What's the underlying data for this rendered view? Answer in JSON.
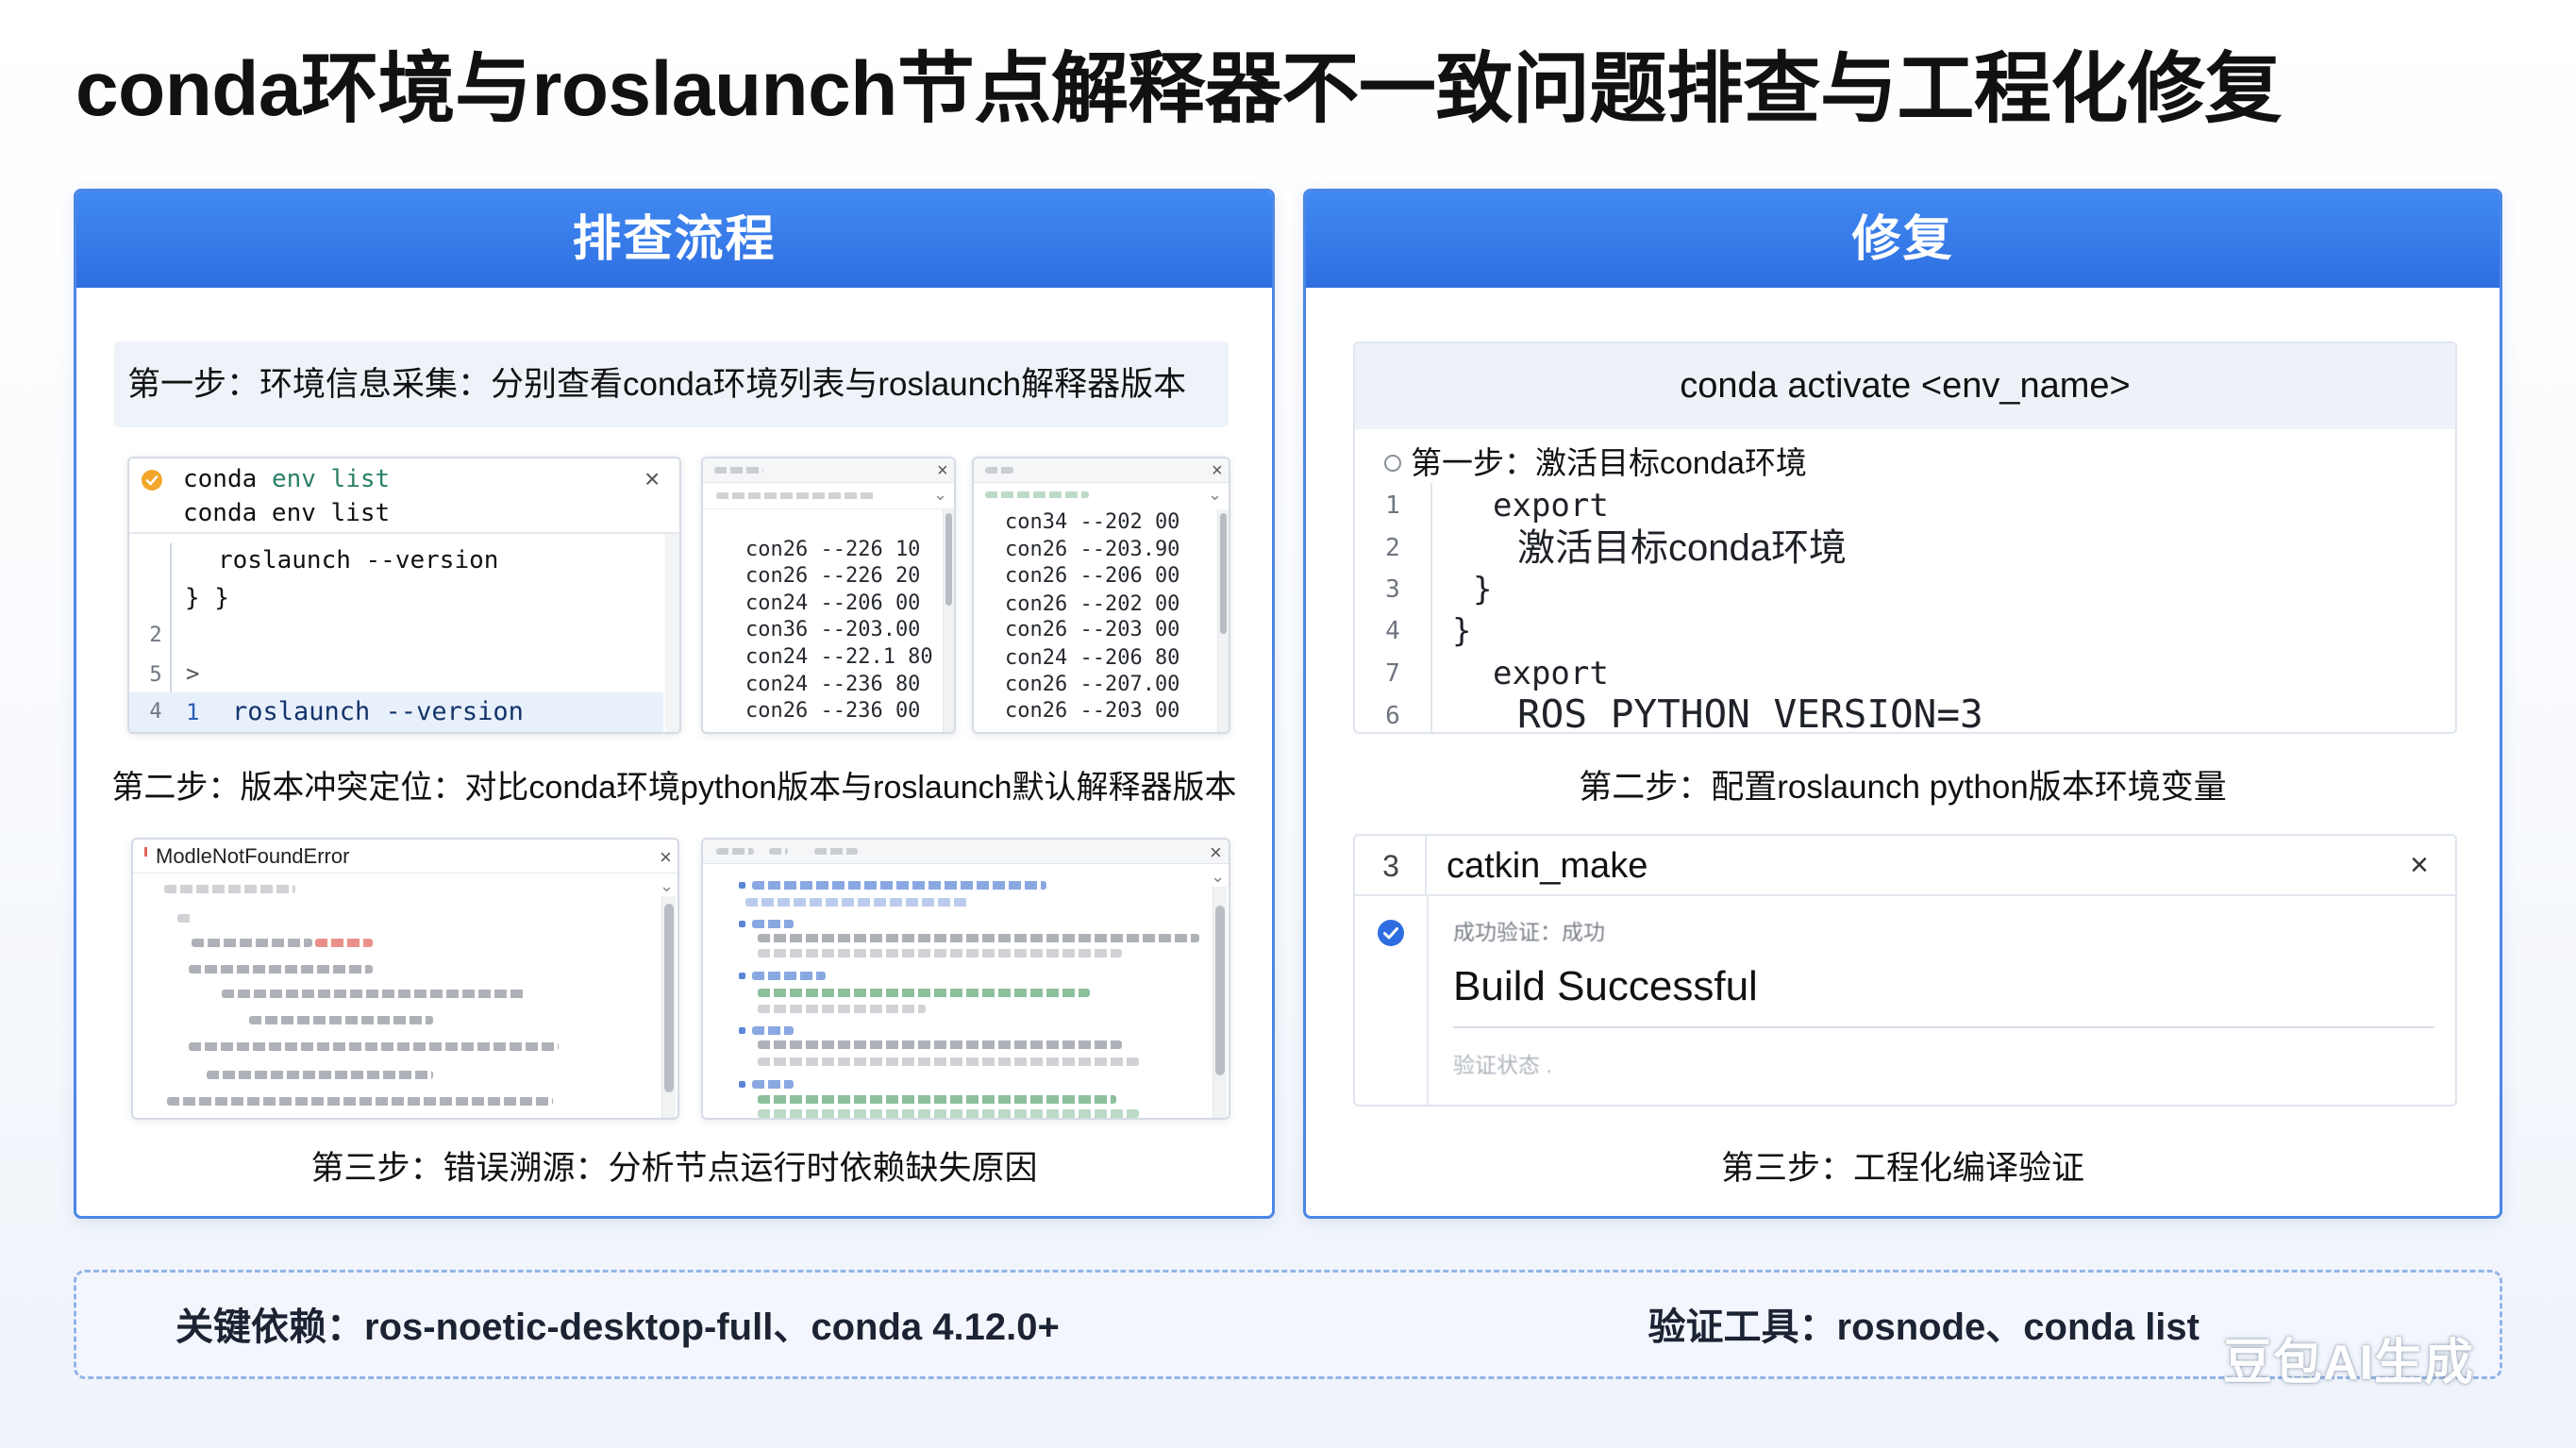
{
  "title": "conda环境与roslaunch节点解释器不一致问题排查与工程化修复",
  "left": {
    "header": "排查流程",
    "step1": "第一步：环境信息采集：分别查看conda环境列表与roslaunch解释器版本",
    "step2": "第二步：版本冲突定位：对比conda环境python版本与roslaunch默认解释器版本",
    "step3": "第三步：错误溯源：分析节点运行时依赖缺失原因",
    "terminal": {
      "title_cmd": "conda",
      "title_args": "env list",
      "line2": "conda env list",
      "line3": "roslaunch --version",
      "line4": "} }",
      "gutter_a": "2",
      "gutter_b": "5",
      "chevron": ">",
      "hl_gutter": "4",
      "hl_num": "1",
      "hl_text": "roslaunch --version",
      "close": "×"
    },
    "version_window_a": {
      "close": "×",
      "chevron": "⌄",
      "lines": [
        "con26 --226 10",
        "con26 --226 20",
        "con24 --206 00",
        "con36 --203.00",
        "con24 --22.1 80",
        "con24 --236 80",
        "con26 --236 00"
      ]
    },
    "version_window_b": {
      "close": "×",
      "chevron": "⌄",
      "lines": [
        "con34 --202 00",
        "con26 --203.90",
        "con26 --206 00",
        "con26 --202 00",
        "con26 --203 00",
        "con24 --206 80",
        "con26 --207.00",
        "con26 --203 00"
      ]
    },
    "error_window": {
      "title": "ModleNotFoundError",
      "close": "×",
      "chevron": "⌄"
    },
    "log_window": {
      "close": "×",
      "chevron": "⌄"
    }
  },
  "right": {
    "header": "修复",
    "code": {
      "header": "conda activate <env_name>",
      "step1": "第一步：激活目标conda环境",
      "rows": [
        {
          "num": "1",
          "code": "export"
        },
        {
          "num": "2",
          "code": "激活目标conda环境"
        },
        {
          "num": "3",
          "code": "}"
        },
        {
          "num": "4",
          "code": "}"
        },
        {
          "num": "7",
          "code": "export"
        },
        {
          "num": "6",
          "code": "ROS_PYTHON_VERSION=3"
        }
      ]
    },
    "step2": "第二步：配置roslaunch python版本环境变量",
    "build": {
      "num": "3",
      "cmd": "catkin_make",
      "close": "×",
      "status_label": "成功验证：成功",
      "result": "Build Successful",
      "note": "验证状态 ."
    },
    "step3": "第三步：工程化编译验证"
  },
  "footer": {
    "deps": "关键依赖：ros-noetic-desktop-full、conda 4.12.0+",
    "tools": "验证工具：rosnode、conda list"
  },
  "watermark": "豆包AI生成",
  "colors": {
    "accent": "#2e6ee0",
    "panel_border": "#4b87e6",
    "warning_icon": "#f4a62a",
    "error_text": "#e0665a",
    "success_icon": "#2e6ee0",
    "highlight_row": "#e8f0fc"
  },
  "icons": [
    "warning-circle-icon",
    "close-icon",
    "chevron-down-icon",
    "radio-circle-icon",
    "check-circle-icon"
  ]
}
